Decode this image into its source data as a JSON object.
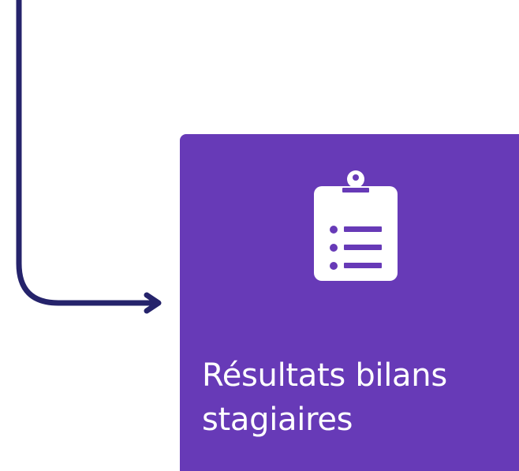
{
  "colors": {
    "connector": "#25236b",
    "tile_background": "#673ab7",
    "icon_foreground": "#ffffff"
  },
  "tile": {
    "icon": "clipboard-list-icon",
    "label_lines": [
      "Résultats bilans",
      "stagiaires"
    ]
  }
}
